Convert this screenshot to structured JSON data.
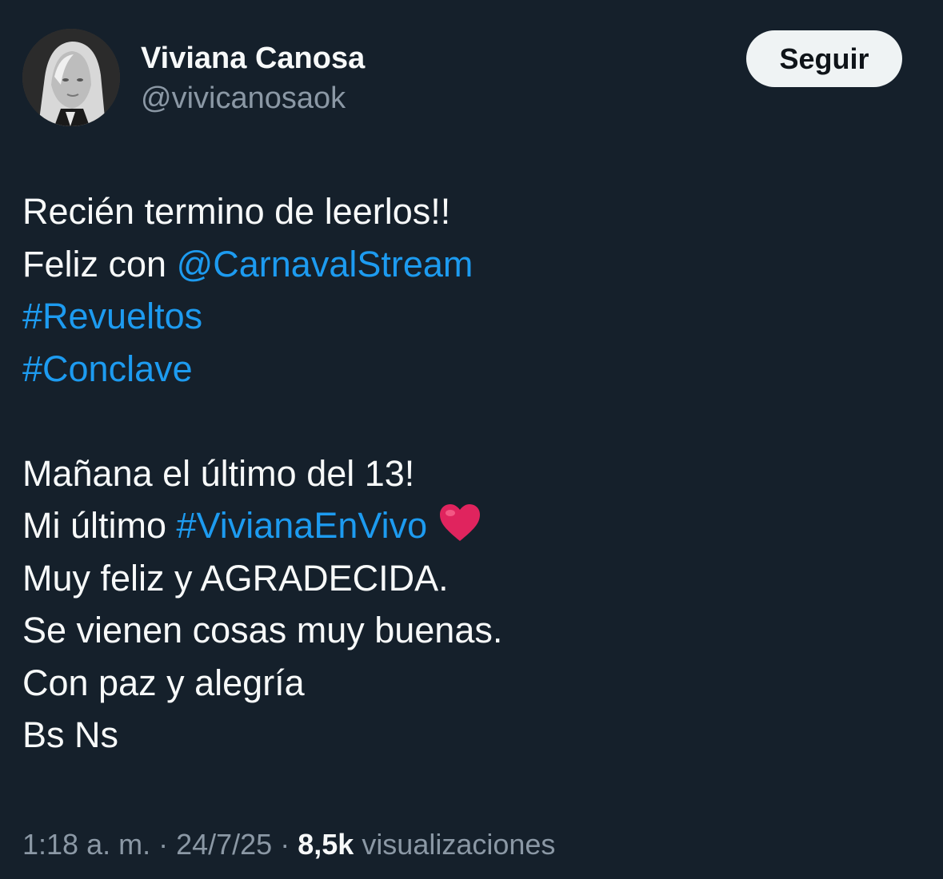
{
  "author": {
    "display_name": "Viviana Canosa",
    "handle": "@vivicanosaok",
    "avatar": "profile-photo"
  },
  "follow_button": {
    "label": "Seguir"
  },
  "tweet": {
    "line1": "Recién termino de leerlos!!",
    "line2_text": "Feliz con ",
    "line2_mention": "@CarnavalStream",
    "hashtag1": "#Revueltos",
    "hashtag2": "#Conclave",
    "line5": "Mañana el último del 13!",
    "line6_text": "Mi último ",
    "line6_hashtag": "#VivianaEnVivo",
    "line6_emoji": "heart-icon",
    "line7": "Muy feliz y AGRADECIDA.",
    "line8": "Se vienen cosas muy buenas.",
    "line9": "Con paz y alegría",
    "line10": "Bs Ns"
  },
  "meta": {
    "time": "1:18 a. m.",
    "separator": " · ",
    "date": "24/7/25",
    "views_count": "8,5k",
    "views_label": "visualizaciones"
  },
  "colors": {
    "background": "#15202b",
    "text": "#f7f9f9",
    "secondary": "#8b98a5",
    "link": "#1d9bf0",
    "button_bg": "#eff3f4",
    "heart": "#e0245e"
  }
}
